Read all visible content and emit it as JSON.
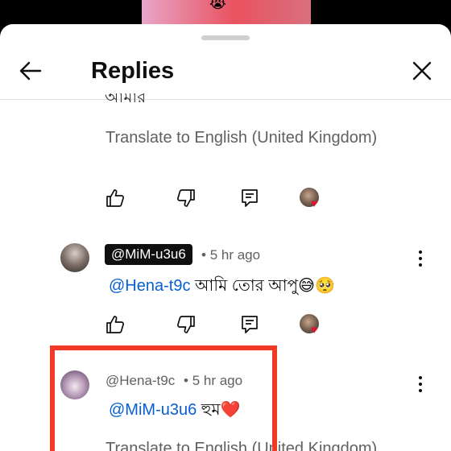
{
  "video": {
    "emoji": "😭"
  },
  "header": {
    "title": "Replies",
    "back_icon": "arrow-left-icon",
    "close_icon": "close-icon"
  },
  "top_comment": {
    "clipped_text": "আমার",
    "translate_label": "Translate to English (United Kingdom)"
  },
  "replies": [
    {
      "author": "@MiM-u3u6",
      "time": "5 hr ago",
      "mention": "@Hena-t9c",
      "text": "আমি তোর আপু😅🥺"
    },
    {
      "author": "@Hena-t9c",
      "time": "5 hr ago",
      "mention": "@MiM-u3u6",
      "text": "হুম❤️",
      "translate_label": "Translate to English (United Kingdom)"
    }
  ],
  "colors": {
    "highlight": "#ef3b26",
    "mention": "#065fd4",
    "heart": "#e0142e"
  }
}
